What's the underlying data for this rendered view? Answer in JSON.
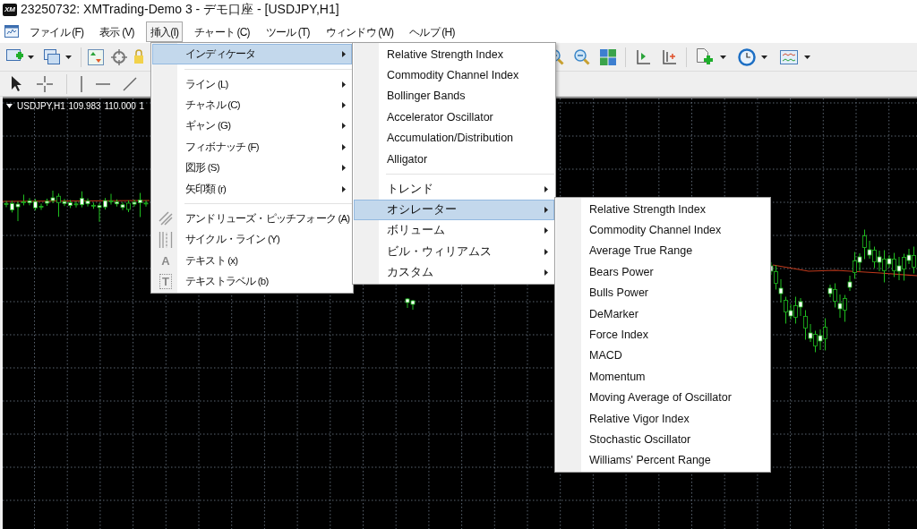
{
  "window": {
    "logo_text": "XM",
    "title": "23250732: XMTrading-Demo 3 - デモ口座 - [USDJPY,H1]"
  },
  "menu_bar": [
    {
      "label": "ファイル (F)",
      "selected": false
    },
    {
      "label": "表示 (V)",
      "selected": false
    },
    {
      "label": "挿入(I)",
      "selected": true
    },
    {
      "label": "チャート (C)",
      "selected": false
    },
    {
      "label": "ツール (T)",
      "selected": false
    },
    {
      "label": "ウィンドウ (W)",
      "selected": false
    },
    {
      "label": "ヘルプ (H)",
      "selected": false
    }
  ],
  "chart": {
    "header": "USDJPY,H1 109.983 110.000 1"
  },
  "insert_menu": {
    "items": [
      {
        "kind": "submenu",
        "label": "インディケータ",
        "selected": true
      },
      {
        "kind": "separator"
      },
      {
        "kind": "submenu",
        "label": "ライン (L)",
        "selected": false
      },
      {
        "kind": "submenu",
        "label": "チャネル (C)",
        "selected": false
      },
      {
        "kind": "submenu",
        "label": "ギャン (G)",
        "selected": false
      },
      {
        "kind": "submenu",
        "label": "フィボナッチ (F)",
        "selected": false
      },
      {
        "kind": "submenu",
        "label": "図形 (S)",
        "selected": false
      },
      {
        "kind": "submenu",
        "label": "矢印類 (r)",
        "selected": false
      },
      {
        "kind": "separator"
      },
      {
        "kind": "command",
        "label": "アンドリューズ・ピッチフォーク (A)",
        "selected": false
      },
      {
        "kind": "command",
        "label": "サイクル・ライン (Y)",
        "selected": false
      },
      {
        "kind": "command",
        "label": "テキスト (x)",
        "selected": false,
        "glyph": "A"
      },
      {
        "kind": "command",
        "label": "テキストラベル (b)",
        "selected": false,
        "glyph": "T"
      }
    ]
  },
  "indicators_menu": {
    "items": [
      {
        "kind": "command",
        "label": "Relative Strength Index",
        "selected": false
      },
      {
        "kind": "command",
        "label": "Commodity Channel Index",
        "selected": false
      },
      {
        "kind": "command",
        "label": "Bollinger Bands",
        "selected": false
      },
      {
        "kind": "command",
        "label": "Accelerator Oscillator",
        "selected": false
      },
      {
        "kind": "command",
        "label": "Accumulation/Distribution",
        "selected": false
      },
      {
        "kind": "command",
        "label": "Alligator",
        "selected": false
      },
      {
        "kind": "separator"
      },
      {
        "kind": "submenu",
        "label": "トレンド",
        "selected": false
      },
      {
        "kind": "submenu",
        "label": "オシレーター",
        "selected": true
      },
      {
        "kind": "submenu",
        "label": "ボリューム",
        "selected": false
      },
      {
        "kind": "submenu",
        "label": "ビル・ウィリアムス",
        "selected": false
      },
      {
        "kind": "submenu",
        "label": "カスタム",
        "selected": false
      }
    ]
  },
  "oscillators_menu": {
    "items": [
      {
        "kind": "command",
        "label": "Relative Strength Index",
        "selected": false
      },
      {
        "kind": "command",
        "label": "Commodity Channel Index",
        "selected": false
      },
      {
        "kind": "command",
        "label": "Average True Range",
        "selected": false
      },
      {
        "kind": "command",
        "label": "Bears Power",
        "selected": false
      },
      {
        "kind": "command",
        "label": "Bulls Power",
        "selected": false
      },
      {
        "kind": "command",
        "label": "DeMarker",
        "selected": false
      },
      {
        "kind": "command",
        "label": "Force Index",
        "selected": false
      },
      {
        "kind": "command",
        "label": "MACD",
        "selected": false
      },
      {
        "kind": "command",
        "label": "Momentum",
        "selected": false
      },
      {
        "kind": "command",
        "label": "Moving Average of Oscillator",
        "selected": false
      },
      {
        "kind": "command",
        "label": "Relative Vigor Index",
        "selected": false
      },
      {
        "kind": "command",
        "label": "Stochastic Oscillator",
        "selected": false
      },
      {
        "kind": "command",
        "label": "Williams' Percent Range",
        "selected": false
      }
    ]
  }
}
